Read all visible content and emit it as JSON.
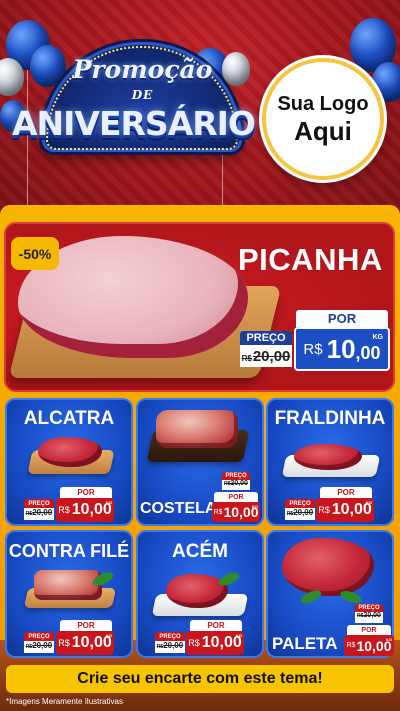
{
  "header": {
    "promo_script": "Promoção",
    "promo_de": "DE",
    "promo_aniversario": "ANIVERSÁRIO",
    "logo_line1": "Sua Logo",
    "logo_line2": "Aqui"
  },
  "featured": {
    "discount_badge": "-50%",
    "name": "PICANHA",
    "old_label": "PREÇO",
    "old_currency": "R$",
    "old_price": "20,00",
    "por_label": "POR",
    "new_currency": "R$",
    "new_price_int": "10",
    "new_price_dec": ",00",
    "unit": "KG"
  },
  "products": [
    {
      "name": "ALCATRA",
      "old_label": "PREÇO",
      "old_currency": "R$",
      "old_price": "20,00",
      "por_label": "POR",
      "new_currency": "R$",
      "new_price": "10,00",
      "unit": "KG"
    },
    {
      "name": "COSTELA",
      "old_label": "PREÇO",
      "old_currency": "R$",
      "old_price": "20,00",
      "por_label": "POR",
      "new_currency": "R$",
      "new_price": "10,00",
      "unit": "KG"
    },
    {
      "name": "FRALDINHA",
      "old_label": "PREÇO",
      "old_currency": "R$",
      "old_price": "20,00",
      "por_label": "POR",
      "new_currency": "R$",
      "new_price": "10,00",
      "unit": "KG"
    },
    {
      "name": "CONTRA FILÉ",
      "old_label": "PREÇO",
      "old_currency": "R$",
      "old_price": "20,00",
      "por_label": "POR",
      "new_currency": "R$",
      "new_price": "10,00",
      "unit": "KG"
    },
    {
      "name": "ACÉM",
      "old_label": "PREÇO",
      "old_currency": "R$",
      "old_price": "20,00",
      "por_label": "POR",
      "new_currency": "R$",
      "new_price": "10,00",
      "unit": "KG"
    },
    {
      "name": "PALETA",
      "old_label": "PREÇO",
      "old_currency": "R$",
      "old_price": "20,00",
      "por_label": "POR",
      "new_currency": "R$",
      "new_price": "10,00",
      "unit": "KG"
    }
  ],
  "footer": {
    "cta": "Crie seu encarte com este tema!",
    "disclaimer": "*Imagens Meramente Ilustrativas"
  },
  "colors": {
    "header_red": "#b0151a",
    "panel_yellow": "#f7b500",
    "card_blue": "#1749c2",
    "price_red": "#c8161c",
    "price_blue": "#1d4fc4",
    "cta_yellow": "#f6c400"
  }
}
